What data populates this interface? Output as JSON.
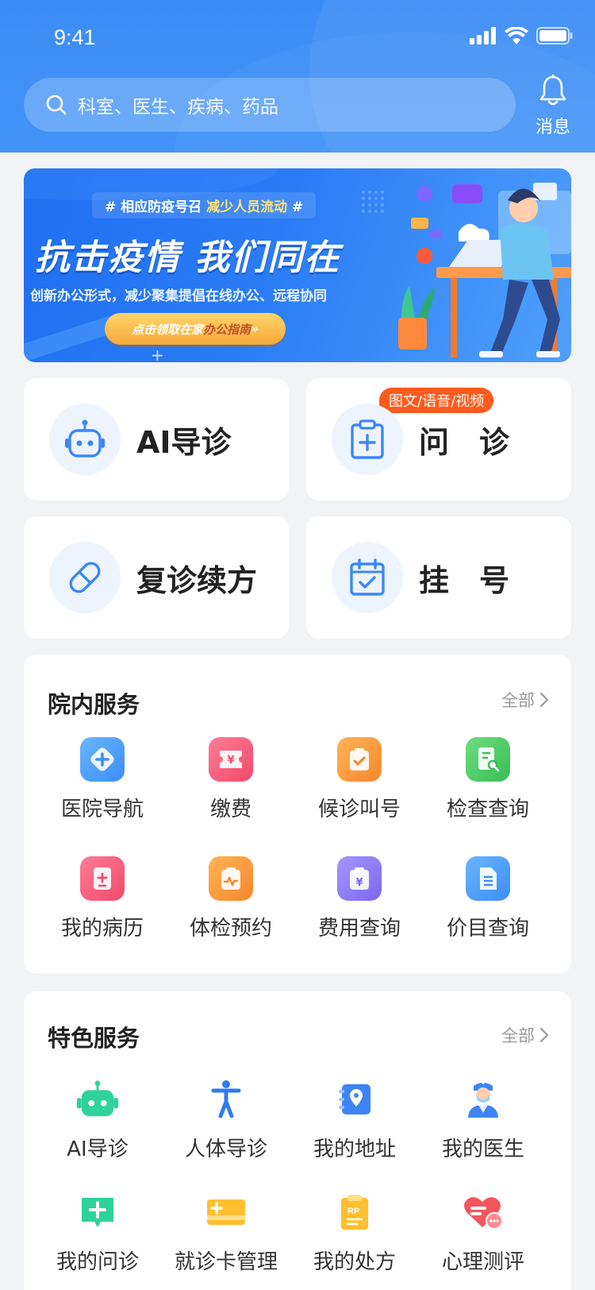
{
  "status_bar": {
    "time": "9:41"
  },
  "header": {
    "search_placeholder": "科室、医生、疾病、药品",
    "message_label": "消息"
  },
  "banner": {
    "tag_prefix": "# 相应防疫号召 ",
    "tag_highlight": "减少人员流动",
    "tag_suffix": " #",
    "title": "抗击疫情 我们同在",
    "subtitle": "创新办公形式，减少聚集提倡在线办公、远程协同",
    "button_prefix": "点击领取在家",
    "button_highlight": "办公指南",
    "button_suffix": " »"
  },
  "quick_actions": [
    {
      "label": "AI导诊",
      "icon": "robot-icon"
    },
    {
      "label": "问　诊",
      "icon": "clipboard-plus-icon",
      "badge": "图文/语音/视频"
    },
    {
      "label": "复诊续方",
      "icon": "pill-icon"
    },
    {
      "label": "挂　号",
      "icon": "calendar-check-icon"
    }
  ],
  "hospital_services": {
    "title": "院内服务",
    "more": "全部",
    "items": [
      {
        "label": "医院导航",
        "icon": "navigation-icon",
        "color": "#4a9df8"
      },
      {
        "label": "缴费",
        "icon": "payment-ticket-icon",
        "color": "#f5577a"
      },
      {
        "label": "候诊叫号",
        "icon": "queue-icon",
        "color": "#fb9a2b"
      },
      {
        "label": "检查查询",
        "icon": "report-search-icon",
        "color": "#47c965"
      },
      {
        "label": "我的病历",
        "icon": "medical-record-icon",
        "color": "#f5577a"
      },
      {
        "label": "体检预约",
        "icon": "checkup-icon",
        "color": "#fb9a2b"
      },
      {
        "label": "费用查询",
        "icon": "fee-query-icon",
        "color": "#8f7cf4"
      },
      {
        "label": "价目查询",
        "icon": "price-list-icon",
        "color": "#4a9df8"
      }
    ]
  },
  "special_services": {
    "title": "特色服务",
    "more": "全部",
    "items": [
      {
        "label": "AI导诊",
        "icon": "robot-icon",
        "color": "#2fd29a"
      },
      {
        "label": "人体导诊",
        "icon": "human-body-icon",
        "color": "#2f7cf0"
      },
      {
        "label": "我的地址",
        "icon": "address-icon",
        "color": "#3d84f7"
      },
      {
        "label": "我的医生",
        "icon": "doctor-icon",
        "color": "#3d84f7"
      },
      {
        "label": "我的问诊",
        "icon": "consult-chat-icon",
        "color": "#2fd29a"
      },
      {
        "label": "就诊卡管理",
        "icon": "medical-card-icon",
        "color": "#ffbf2f"
      },
      {
        "label": "我的处方",
        "icon": "prescription-icon",
        "color": "#ffbf2f"
      },
      {
        "label": "心理测评",
        "icon": "heart-chat-icon",
        "color": "#f5555d"
      }
    ]
  }
}
